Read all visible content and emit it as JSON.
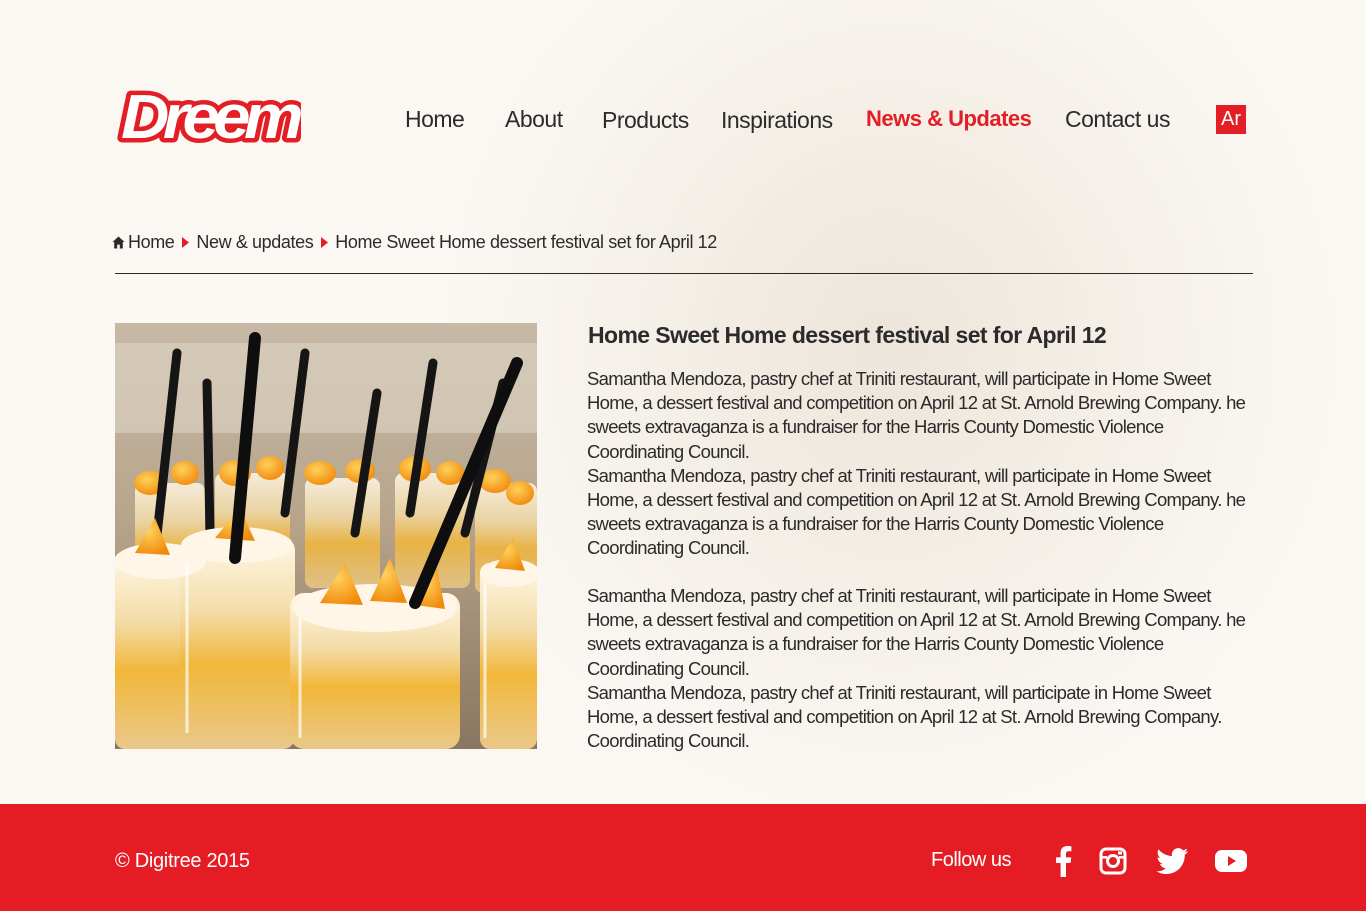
{
  "brand": {
    "logo_text": "Dreem",
    "accent_color": "#e31e24",
    "footer_color": "#e61c24"
  },
  "nav": {
    "items": [
      {
        "label": "Home"
      },
      {
        "label": "About"
      },
      {
        "label": "Products"
      },
      {
        "label": "Inspirations"
      },
      {
        "label": "News & Updates",
        "active": true
      },
      {
        "label": "Contact us"
      }
    ],
    "lang_label": "Ar"
  },
  "breadcrumb": {
    "items": [
      "Home",
      "New & updates",
      "Home Sweet Home dessert festival set for April 12"
    ]
  },
  "article": {
    "image_alt": "Mango dessert cups with black spoons",
    "title": "Home Sweet Home dessert festival set for April 12",
    "blocks": [
      {
        "paragraphs": [
          "Samantha Mendoza, pastry chef at Triniti restaurant, will participate in Home Sweet Home, a dessert festival and competition on April 12 at St. Arnold Brewing Company. he sweets extravaganza is a fundraiser for the Harris County Domestic Violence Coordinating Council.",
          "Samantha Mendoza, pastry chef at Triniti restaurant, will participate in Home Sweet Home, a dessert festival and competition on April 12 at St. Arnold Brewing Company. he sweets extravaganza is a fundraiser for the Harris County Domestic Violence Coordinating Council."
        ]
      },
      {
        "paragraphs": [
          "Samantha Mendoza, pastry chef at Triniti restaurant, will participate in Home Sweet Home, a dessert festival and competition on April 12 at St. Arnold Brewing Company. he sweets extravaganza is a fundraiser for the Harris County Domestic Violence Coordinating Council.",
          "Samantha Mendoza, pastry chef at Triniti restaurant, will participate in Home Sweet Home, a dessert festival and competition on April 12 at St. Arnold Brewing Company. Coordinating Council."
        ]
      }
    ]
  },
  "footer": {
    "copyright": "© Digitree 2015",
    "follow_label": "Follow us",
    "social": [
      "facebook-icon",
      "instagram-icon",
      "twitter-icon",
      "youtube-icon"
    ]
  }
}
